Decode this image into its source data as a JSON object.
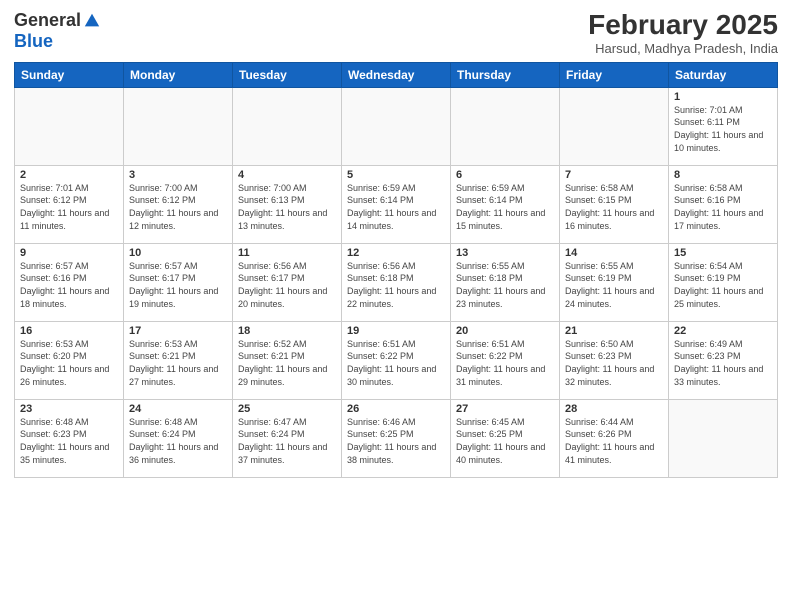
{
  "logo": {
    "general": "General",
    "blue": "Blue"
  },
  "header": {
    "month": "February 2025",
    "location": "Harsud, Madhya Pradesh, India"
  },
  "weekdays": [
    "Sunday",
    "Monday",
    "Tuesday",
    "Wednesday",
    "Thursday",
    "Friday",
    "Saturday"
  ],
  "weeks": [
    [
      {
        "day": "",
        "info": ""
      },
      {
        "day": "",
        "info": ""
      },
      {
        "day": "",
        "info": ""
      },
      {
        "day": "",
        "info": ""
      },
      {
        "day": "",
        "info": ""
      },
      {
        "day": "",
        "info": ""
      },
      {
        "day": "1",
        "info": "Sunrise: 7:01 AM\nSunset: 6:11 PM\nDaylight: 11 hours\nand 10 minutes."
      }
    ],
    [
      {
        "day": "2",
        "info": "Sunrise: 7:01 AM\nSunset: 6:12 PM\nDaylight: 11 hours\nand 11 minutes."
      },
      {
        "day": "3",
        "info": "Sunrise: 7:00 AM\nSunset: 6:12 PM\nDaylight: 11 hours\nand 12 minutes."
      },
      {
        "day": "4",
        "info": "Sunrise: 7:00 AM\nSunset: 6:13 PM\nDaylight: 11 hours\nand 13 minutes."
      },
      {
        "day": "5",
        "info": "Sunrise: 6:59 AM\nSunset: 6:14 PM\nDaylight: 11 hours\nand 14 minutes."
      },
      {
        "day": "6",
        "info": "Sunrise: 6:59 AM\nSunset: 6:14 PM\nDaylight: 11 hours\nand 15 minutes."
      },
      {
        "day": "7",
        "info": "Sunrise: 6:58 AM\nSunset: 6:15 PM\nDaylight: 11 hours\nand 16 minutes."
      },
      {
        "day": "8",
        "info": "Sunrise: 6:58 AM\nSunset: 6:16 PM\nDaylight: 11 hours\nand 17 minutes."
      }
    ],
    [
      {
        "day": "9",
        "info": "Sunrise: 6:57 AM\nSunset: 6:16 PM\nDaylight: 11 hours\nand 18 minutes."
      },
      {
        "day": "10",
        "info": "Sunrise: 6:57 AM\nSunset: 6:17 PM\nDaylight: 11 hours\nand 19 minutes."
      },
      {
        "day": "11",
        "info": "Sunrise: 6:56 AM\nSunset: 6:17 PM\nDaylight: 11 hours\nand 20 minutes."
      },
      {
        "day": "12",
        "info": "Sunrise: 6:56 AM\nSunset: 6:18 PM\nDaylight: 11 hours\nand 22 minutes."
      },
      {
        "day": "13",
        "info": "Sunrise: 6:55 AM\nSunset: 6:18 PM\nDaylight: 11 hours\nand 23 minutes."
      },
      {
        "day": "14",
        "info": "Sunrise: 6:55 AM\nSunset: 6:19 PM\nDaylight: 11 hours\nand 24 minutes."
      },
      {
        "day": "15",
        "info": "Sunrise: 6:54 AM\nSunset: 6:19 PM\nDaylight: 11 hours\nand 25 minutes."
      }
    ],
    [
      {
        "day": "16",
        "info": "Sunrise: 6:53 AM\nSunset: 6:20 PM\nDaylight: 11 hours\nand 26 minutes."
      },
      {
        "day": "17",
        "info": "Sunrise: 6:53 AM\nSunset: 6:21 PM\nDaylight: 11 hours\nand 27 minutes."
      },
      {
        "day": "18",
        "info": "Sunrise: 6:52 AM\nSunset: 6:21 PM\nDaylight: 11 hours\nand 29 minutes."
      },
      {
        "day": "19",
        "info": "Sunrise: 6:51 AM\nSunset: 6:22 PM\nDaylight: 11 hours\nand 30 minutes."
      },
      {
        "day": "20",
        "info": "Sunrise: 6:51 AM\nSunset: 6:22 PM\nDaylight: 11 hours\nand 31 minutes."
      },
      {
        "day": "21",
        "info": "Sunrise: 6:50 AM\nSunset: 6:23 PM\nDaylight: 11 hours\nand 32 minutes."
      },
      {
        "day": "22",
        "info": "Sunrise: 6:49 AM\nSunset: 6:23 PM\nDaylight: 11 hours\nand 33 minutes."
      }
    ],
    [
      {
        "day": "23",
        "info": "Sunrise: 6:48 AM\nSunset: 6:23 PM\nDaylight: 11 hours\nand 35 minutes."
      },
      {
        "day": "24",
        "info": "Sunrise: 6:48 AM\nSunset: 6:24 PM\nDaylight: 11 hours\nand 36 minutes."
      },
      {
        "day": "25",
        "info": "Sunrise: 6:47 AM\nSunset: 6:24 PM\nDaylight: 11 hours\nand 37 minutes."
      },
      {
        "day": "26",
        "info": "Sunrise: 6:46 AM\nSunset: 6:25 PM\nDaylight: 11 hours\nand 38 minutes."
      },
      {
        "day": "27",
        "info": "Sunrise: 6:45 AM\nSunset: 6:25 PM\nDaylight: 11 hours\nand 40 minutes."
      },
      {
        "day": "28",
        "info": "Sunrise: 6:44 AM\nSunset: 6:26 PM\nDaylight: 11 hours\nand 41 minutes."
      },
      {
        "day": "",
        "info": ""
      }
    ]
  ]
}
